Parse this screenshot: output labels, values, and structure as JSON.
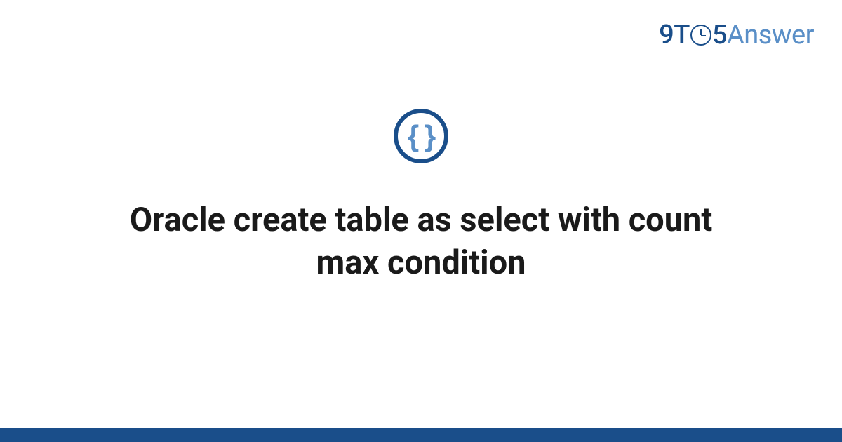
{
  "logo": {
    "part1": "9T",
    "part2": "5",
    "part3": "Answer"
  },
  "category_icon": {
    "glyph": "{ }",
    "name": "code-braces"
  },
  "title": "Oracle create table as select with count max condition",
  "colors": {
    "primary": "#1a4e8a",
    "secondary": "#5a8fc7"
  }
}
